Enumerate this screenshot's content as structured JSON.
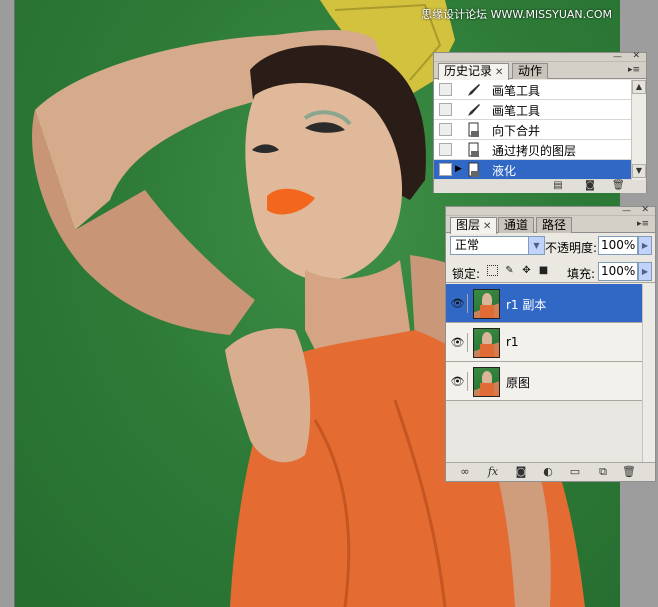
{
  "watermark": "思缘设计论坛 WWW.MISSYUAN.COM",
  "history_panel": {
    "tabs": [
      {
        "label": "历史记录",
        "active": true
      },
      {
        "label": "动作",
        "active": false
      }
    ],
    "items": [
      {
        "label": "画笔工具",
        "icon": "brush-icon",
        "selected": false
      },
      {
        "label": "画笔工具",
        "icon": "brush-icon",
        "selected": false
      },
      {
        "label": "向下合并",
        "icon": "document-icon",
        "selected": false
      },
      {
        "label": "通过拷贝的图层",
        "icon": "document-icon",
        "selected": false
      },
      {
        "label": "液化",
        "icon": "document-icon",
        "selected": true
      }
    ],
    "footer_icons": [
      "new-document-from-state-icon",
      "new-snapshot-icon",
      "trash-icon"
    ]
  },
  "layers_panel": {
    "tabs": [
      {
        "label": "图层",
        "active": true
      },
      {
        "label": "通道",
        "active": false
      },
      {
        "label": "路径",
        "active": false
      }
    ],
    "blend_mode": "正常",
    "opacity_label": "不透明度:",
    "opacity_value": "100%",
    "lock_label": "锁定:",
    "fill_label": "填充:",
    "fill_value": "100%",
    "layers": [
      {
        "name": "r1 副本",
        "visible": true,
        "selected": true
      },
      {
        "name": "r1",
        "visible": true,
        "selected": false
      },
      {
        "name": "原图",
        "visible": true,
        "selected": false
      }
    ],
    "footer_icons": [
      "link-icon",
      "fx-icon",
      "mask-icon",
      "adjustment-icon",
      "folder-icon",
      "new-layer-icon",
      "trash-icon"
    ]
  },
  "colors": {
    "selection": "#3168c6",
    "panel_bg": "#eae8e1",
    "backdrop_green": "#2e7c38"
  }
}
